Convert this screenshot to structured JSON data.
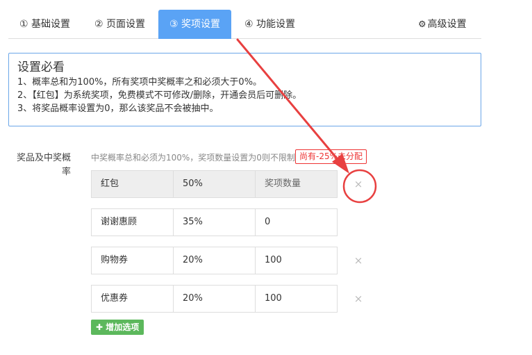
{
  "tabs": [
    {
      "label": "① 基础设置"
    },
    {
      "label": "② 页面设置"
    },
    {
      "label": "③ 奖项设置"
    },
    {
      "label": "④ 功能设置"
    },
    {
      "label": "高级设置"
    }
  ],
  "notice": {
    "title": "设置必看",
    "lines": [
      "1、概率总和为100%，所有奖项中奖概率之和必须大于0%。",
      "2、【红包】为系统奖项，免费模式不可修改/删除，开通会员后可删除。",
      "3、将奖品概率设置为0，那么该奖品不会被抽中。"
    ]
  },
  "form": {
    "label": "奖品及中奖概率",
    "hint": "中奖概率总和必须为100%，奖项数量设置为0则不限制",
    "warning": "尚有-25%未分配",
    "rows": [
      {
        "name": "红包",
        "prob": "50%",
        "qty": "奖项数量"
      },
      {
        "name": "谢谢惠顾",
        "prob": "35%",
        "qty": "0"
      },
      {
        "name": "购物券",
        "prob": "20%",
        "qty": "100"
      },
      {
        "name": "优惠券",
        "prob": "20%",
        "qty": "100"
      }
    ],
    "delete_symbol": "×",
    "add_label": "增加选项"
  },
  "colors": {
    "tab_active": "#5aa3f5",
    "notice_border": "#6aa6e8",
    "warning": "#e33333",
    "add_button": "#5cb85c",
    "annotation": "#e84040"
  }
}
